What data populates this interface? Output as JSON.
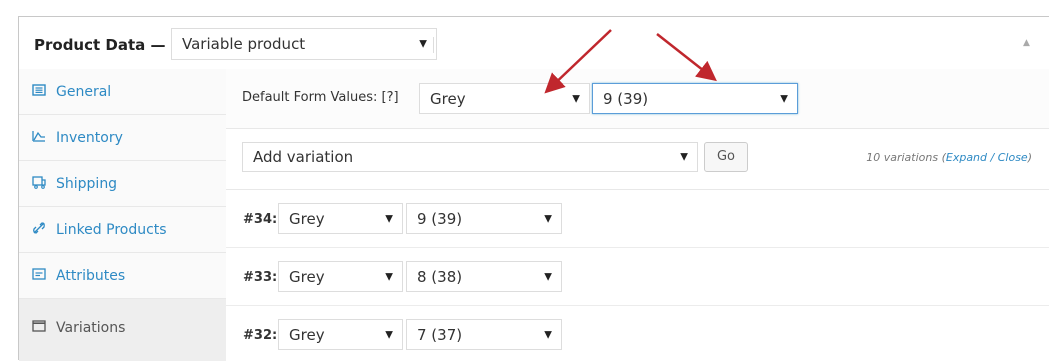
{
  "header": {
    "title": "Product Data —",
    "product_type": "Variable product"
  },
  "sidebar": {
    "tabs": [
      {
        "label": "General",
        "icon": "general-icon"
      },
      {
        "label": "Inventory",
        "icon": "inventory-icon"
      },
      {
        "label": "Shipping",
        "icon": "shipping-icon"
      },
      {
        "label": "Linked Products",
        "icon": "link-icon"
      },
      {
        "label": "Attributes",
        "icon": "attributes-icon"
      },
      {
        "label": "Variations",
        "icon": "variations-icon",
        "active": true
      }
    ]
  },
  "defaults": {
    "label": "Default Form Values: [?]",
    "color": "Grey",
    "size": "9 (39)"
  },
  "add_variation": {
    "select": "Add variation",
    "go": "Go",
    "count": "10 variations",
    "expand": "Expand",
    "separator": "/",
    "close": "Close"
  },
  "variations": [
    {
      "number": "#34:",
      "color": "Grey",
      "size": "9 (39)"
    },
    {
      "number": "#33:",
      "color": "Grey",
      "size": "8 (38)"
    },
    {
      "number": "#32:",
      "color": "Grey",
      "size": "7 (37)"
    }
  ],
  "colors": {
    "link": "#2e8ac4",
    "focus_border": "#5b9dd9",
    "annotation_arrow": "#c0272d"
  }
}
